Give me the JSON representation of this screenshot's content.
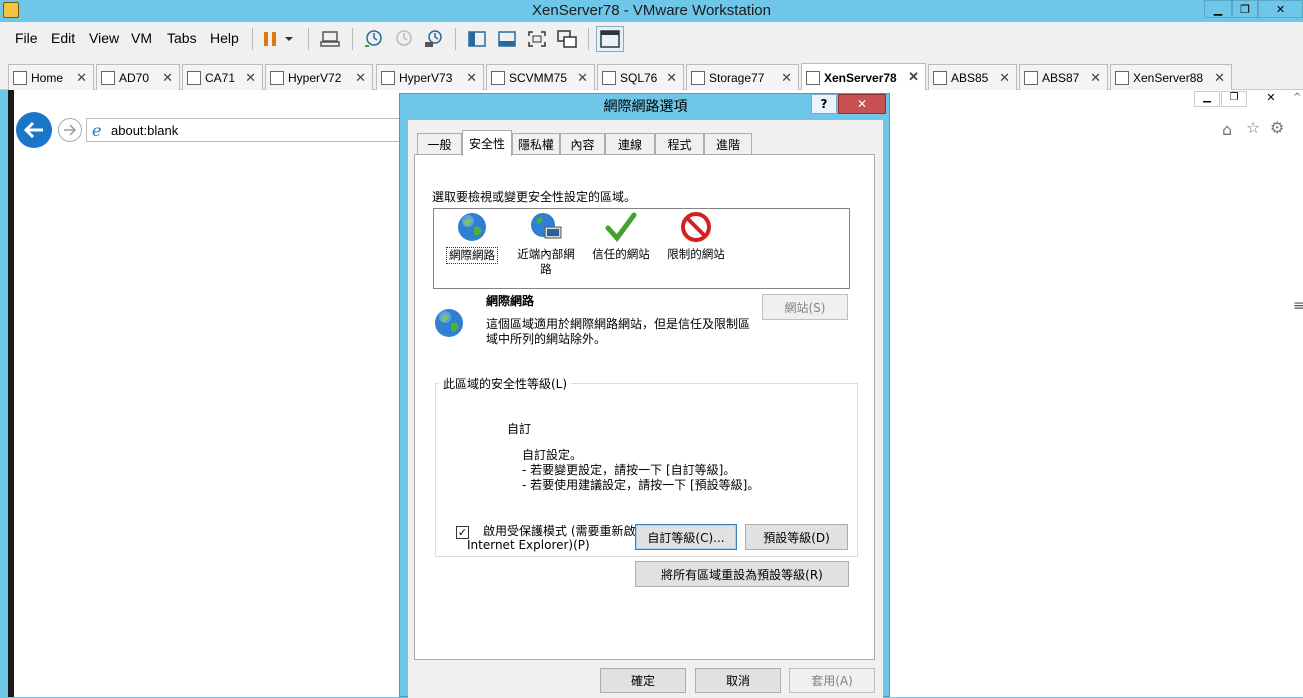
{
  "window": {
    "title": "XenServer78 - VMware Workstation",
    "minimize": "▁",
    "restore": "❐",
    "close": "✕"
  },
  "menu": {
    "file": "File",
    "edit": "Edit",
    "view": "View",
    "vm": "VM",
    "tabs": "Tabs",
    "help": "Help"
  },
  "vm_tabs": [
    {
      "label": "Home"
    },
    {
      "label": "AD70"
    },
    {
      "label": "CA71"
    },
    {
      "label": "HyperV72"
    },
    {
      "label": "HyperV73"
    },
    {
      "label": "SCVMM75"
    },
    {
      "label": "SQL76"
    },
    {
      "label": "Storage77"
    },
    {
      "label": "XenServer78"
    },
    {
      "label": "ABS85"
    },
    {
      "label": "ABS87"
    },
    {
      "label": "XenServer88"
    }
  ],
  "active_tab": "XenServer78",
  "browser": {
    "address": "about:blank",
    "guest_min": "▁",
    "guest_restore": "❐",
    "guest_close": "✕"
  },
  "dialog": {
    "title": "網際網路選項",
    "help": "?",
    "close": "✕",
    "tabs": [
      "一般",
      "安全性",
      "隱私權",
      "內容",
      "連線",
      "程式",
      "進階"
    ],
    "selected_tab": "安全性",
    "zone_prompt": "選取要檢視或變更安全性設定的區域。",
    "zones": [
      {
        "label": "網際網路",
        "icon": "globe-icon"
      },
      {
        "label": "近端內部網路",
        "icon": "intranet-icon"
      },
      {
        "label": "信任的網站",
        "icon": "check-icon"
      },
      {
        "label": "限制的網站",
        "icon": "restricted-icon"
      }
    ],
    "selected_zone": "網際網路",
    "zone_desc_title": "網際網路",
    "zone_desc_line1": "這個區域適用於網際網路網站，但是信任及限制區",
    "zone_desc_line2": "域中所列的網站除外。",
    "sites_button": "網站(S)",
    "level_group_label": "此區域的安全性等級(L)",
    "level_name": "自訂",
    "level_desc1": "自訂設定。",
    "level_desc2": "- 若要變更設定，請按一下 [自訂等級]。",
    "level_desc3": "- 若要使用建議設定，請按一下 [預設等級]。",
    "protected_mode_line1": "啟用受保護模式 (需要重新啟動",
    "protected_mode_line2": "Internet Explorer)(P)",
    "protected_mode_checked": true,
    "custom_level_button": "自訂等級(C)...",
    "default_level_button": "預設等級(D)",
    "reset_all_button": "將所有區域重設為預設等級(R)",
    "ok_button": "確定",
    "cancel_button": "取消",
    "apply_button": "套用(A)"
  },
  "colors": {
    "titlebar": "#6ec6e8",
    "close_red": "#c75050",
    "ie_blue": "#1b75c9"
  }
}
